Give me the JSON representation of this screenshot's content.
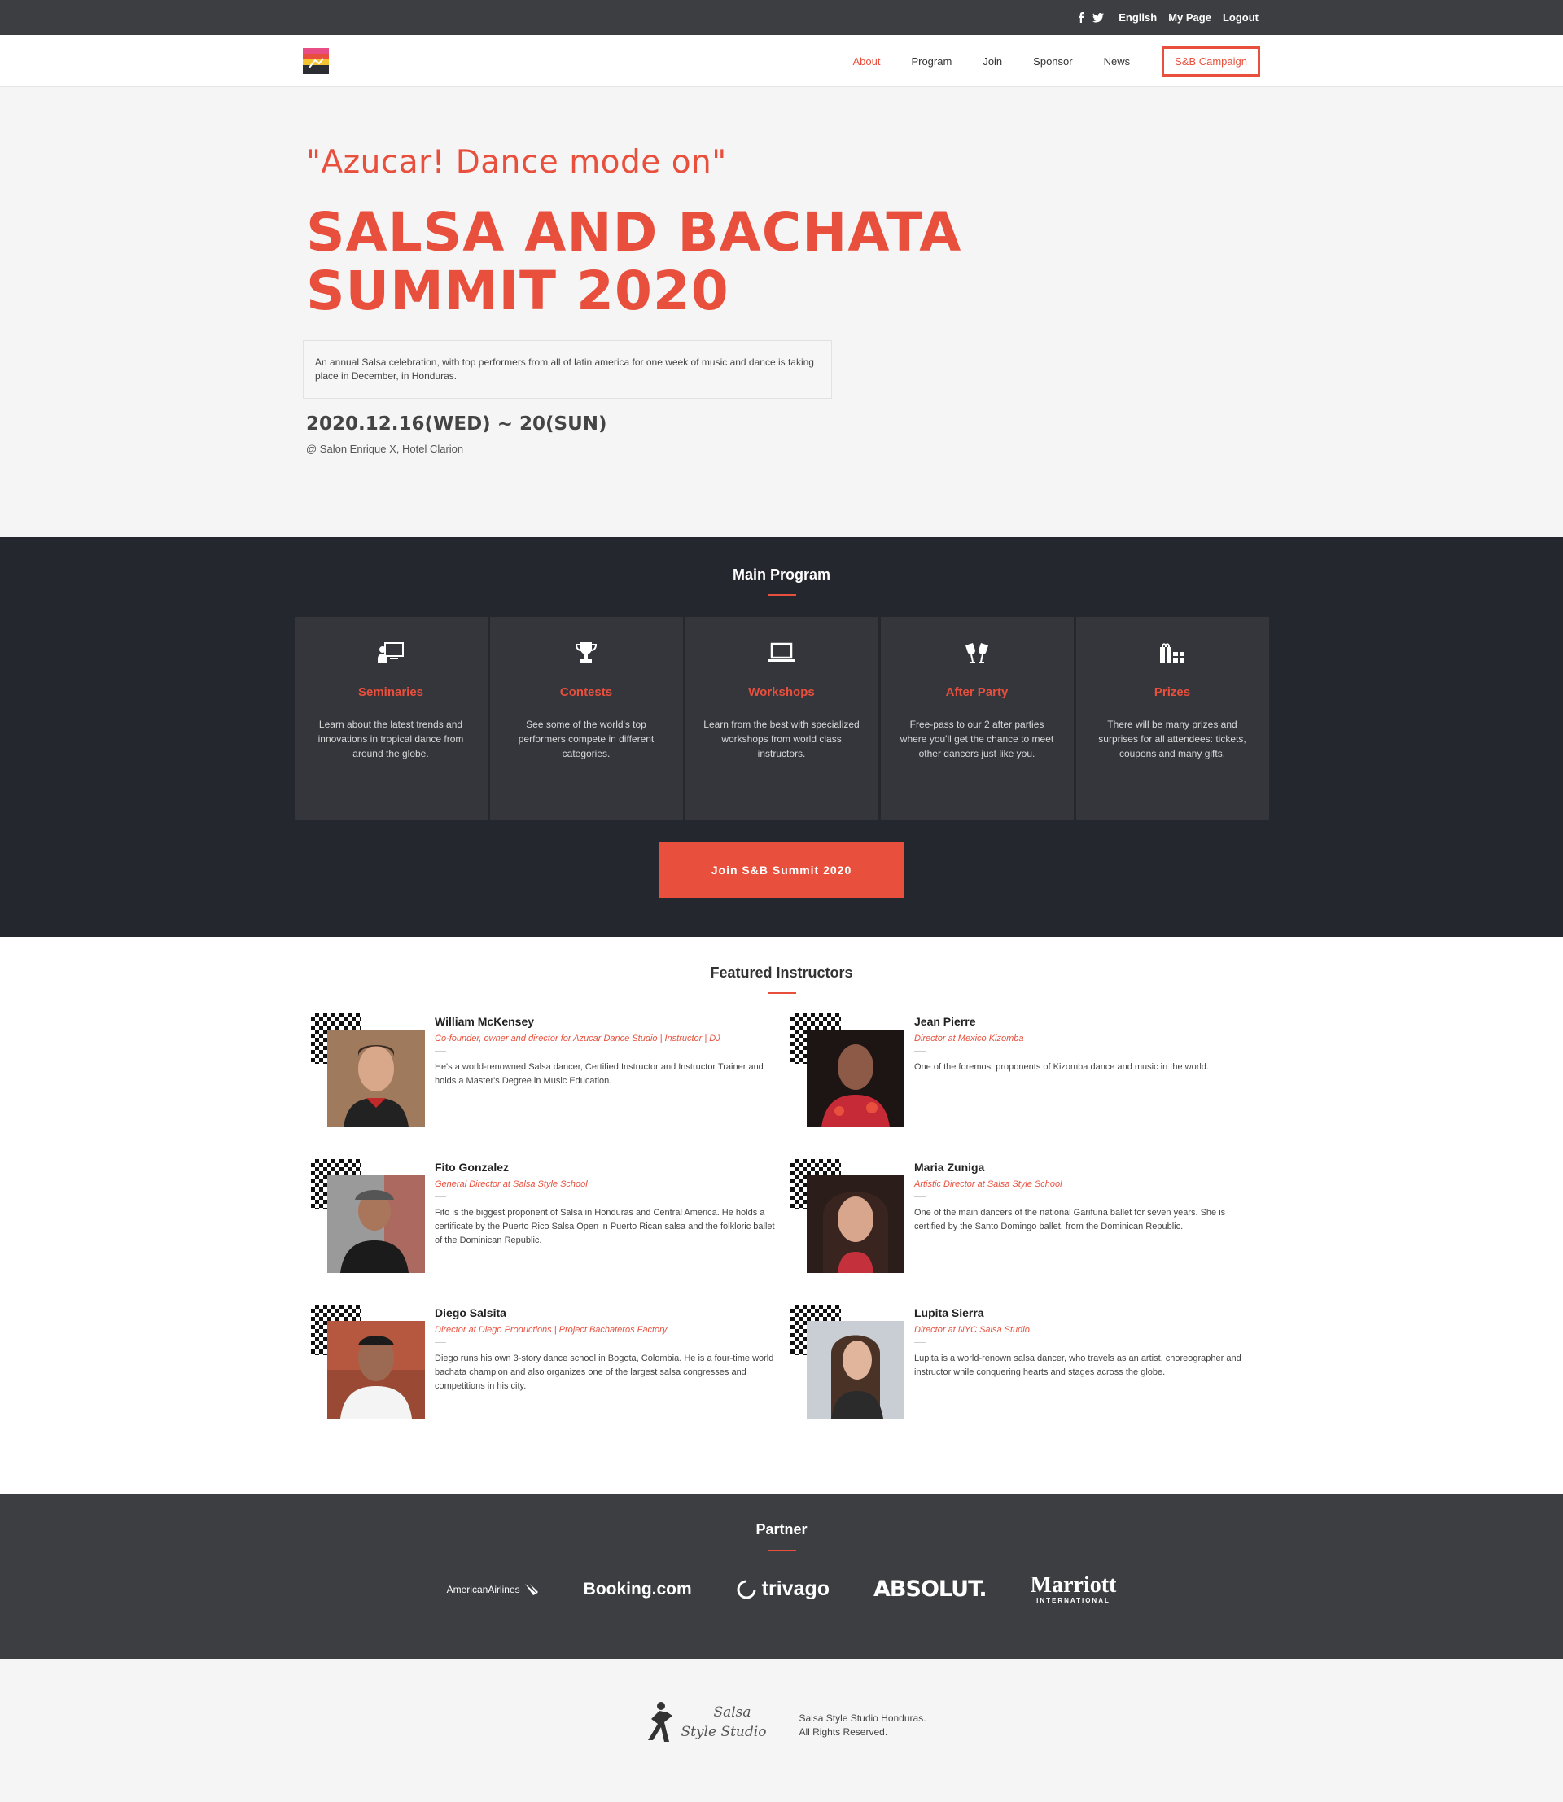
{
  "topbar": {
    "facebook": "facebook-icon",
    "twitter": "twitter-icon",
    "language": "English",
    "mypage": "My Page",
    "logout": "Logout"
  },
  "nav": {
    "items": [
      "About",
      "Program",
      "Join",
      "Sponsor",
      "News"
    ],
    "active": "About",
    "cta": "S&B Campaign"
  },
  "hero": {
    "subtitle": "\"Azucar! Dance mode on\"",
    "title": "SALSA AND BACHATA SUMMIT 2020",
    "description": "An annual Salsa celebration, with top performers from all of latin america for one week of music and dance is taking place in December, in Honduras.",
    "date": "2020.12.16(WED) ~ 20(SUN)",
    "venue": "@ Salon Enrique X, Hotel Clarion"
  },
  "program": {
    "title": "Main Program",
    "cards": [
      {
        "icon": "presentation-icon",
        "title": "Seminaries",
        "text": "Learn about the latest trends and innovations in tropical dance from around the globe."
      },
      {
        "icon": "trophy-icon",
        "title": "Contests",
        "text": "See some of the world's top performers compete in different categories."
      },
      {
        "icon": "laptop-icon",
        "title": "Workshops",
        "text": "Learn from the best with specialized workshops from world class instructors."
      },
      {
        "icon": "glasses-cheers-icon",
        "title": "After Party",
        "text": "Free-pass to our 2 after parties where you'll get the chance to meet other dancers just like you."
      },
      {
        "icon": "gifts-icon",
        "title": "Prizes",
        "text": "There will be many prizes and surprises for all attendees: tickets, coupons and many gifts."
      }
    ],
    "join_label": "Join S&B Summit 2020"
  },
  "instructors": {
    "title": "Featured Instructors",
    "list": [
      {
        "name": "William McKensey",
        "role": "Co-founder, owner and director for Azucar Dance Studio | Instructor | DJ",
        "bio": "He's a world-renowned Salsa dancer, Certified Instructor and Instructor Trainer and holds a Master's Degree in Music Education."
      },
      {
        "name": "Jean Pierre",
        "role": "Director at Mexico Kizomba",
        "bio": "One of the foremost proponents of Kizomba dance and music in the world."
      },
      {
        "name": "Fito Gonzalez",
        "role": "General Director at Salsa Style School",
        "bio": "Fito is the biggest proponent of Salsa in Honduras and Central America. He holds a certificate by the Puerto Rico Salsa Open in Puerto Rican salsa and the folkloric ballet of the Dominican Republic."
      },
      {
        "name": "Maria Zuniga",
        "role": "Artistic Director at Salsa Style School",
        "bio": "One of the main dancers of the national Garifuna ballet for seven years. She is certified by the Santo Domingo ballet, from the Dominican Republic."
      },
      {
        "name": "Diego Salsita",
        "role": "Director at Diego Productions | Project Bachateros Factory",
        "bio": "Diego runs his own 3-story dance school in Bogota, Colombia. He is a four-time world bachata champion and also organizes one of the largest salsa congresses and competitions in his city."
      },
      {
        "name": "Lupita Sierra",
        "role": "Director at NYC Salsa Studio",
        "bio": "Lupita is a world-renown salsa dancer, who travels as an artist, choreographer and instructor while conquering hearts and stages across the globe."
      }
    ]
  },
  "partner": {
    "title": "Partner",
    "logos": {
      "american": "AmericanAirlines",
      "booking": "Booking.com",
      "trivago": "trivago",
      "absolut": "ABSOLUT.",
      "marriott": "Marriott",
      "marriott_sub": "INTERNATIONAL"
    }
  },
  "footer": {
    "logo_line1": "Salsa",
    "logo_line2": "Style Studio",
    "line1": "Salsa Style Studio Honduras.",
    "line2": "All Rights Reserved."
  },
  "colors": {
    "accent": "#e8503d",
    "dark": "#25272e",
    "card": "#34363c",
    "bar": "#3d3e42"
  }
}
